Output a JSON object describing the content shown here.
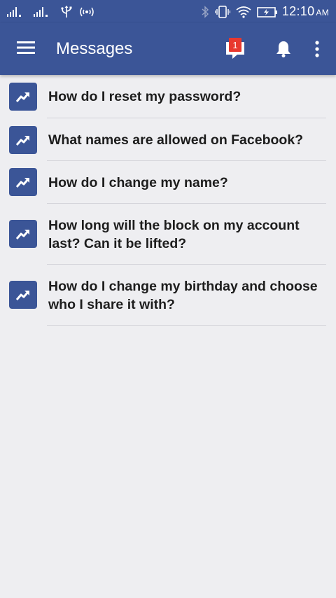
{
  "status_bar": {
    "time": "12:10",
    "ampm": "AM"
  },
  "app_bar": {
    "title": "Messages",
    "message_badge_count": "1"
  },
  "questions": [
    "How do I reset my password?",
    "What names are allowed on Facebook?",
    "How do I change my name?",
    "How long will the block on my account last? Can it be lifted?",
    "How do I change my birthday and choose who I share it with?"
  ],
  "colors": {
    "brand": "#3b5597",
    "badge": "#e8382e",
    "background": "#eeeef1"
  },
  "icons": {
    "list_item": "trending-up-icon"
  }
}
